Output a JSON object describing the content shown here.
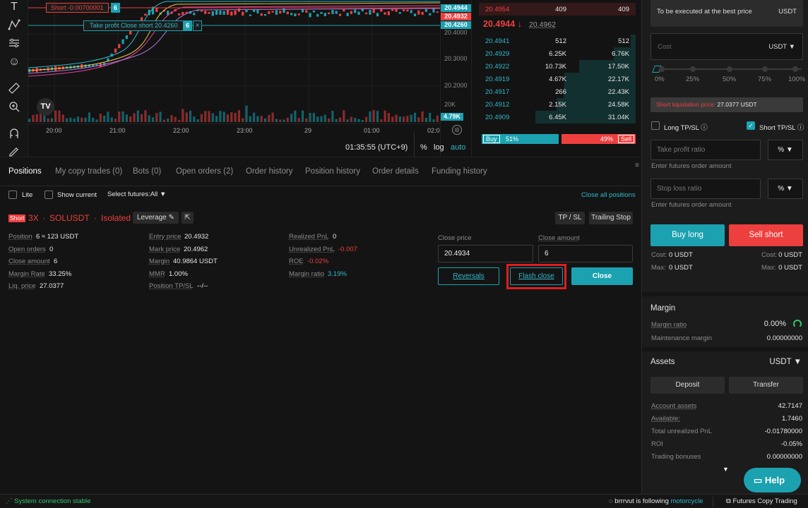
{
  "chart": {
    "time_labels": [
      "20:00",
      "21:00",
      "22:00",
      "23:00",
      "29",
      "01:00",
      "02:0"
    ],
    "price_labels": [
      "20.4000",
      "20.3000",
      "20.2000",
      "20K"
    ],
    "price_tags": [
      {
        "value": "20.4944",
        "color": "#1ba1b0"
      },
      {
        "value": "20.4932",
        "color": "#ee3f3f"
      },
      {
        "value": "20.4260",
        "color": "#1ba1b0"
      }
    ],
    "volume_tag": "4.79K",
    "short_line_label": "Short -0.00700001",
    "short_line_qty": "6",
    "tp_line_label": "Take profit Close short 20.4260",
    "tp_line_qty": "6",
    "clock": "01:35:55 (UTC+9)",
    "scale_percent": "%",
    "scale_log": "log",
    "scale_auto": "auto",
    "logo_text": "TV"
  },
  "orderbook": {
    "top_row": {
      "price": "20.4954",
      "amount": "409",
      "total": "409"
    },
    "last_price": "20.4944",
    "mark_price": "20.4962",
    "bids": [
      {
        "price": "20.4941",
        "amount": "512",
        "total": "512",
        "depth": 0.05
      },
      {
        "price": "20.4929",
        "amount": "6.25K",
        "total": "6.76K",
        "depth": 0.22
      },
      {
        "price": "20.4922",
        "amount": "10.73K",
        "total": "17.50K",
        "depth": 0.56
      },
      {
        "price": "20.4919",
        "amount": "4.67K",
        "total": "22.17K",
        "depth": 0.71
      },
      {
        "price": "20.4917",
        "amount": "266",
        "total": "22.43K",
        "depth": 0.72
      },
      {
        "price": "20.4912",
        "amount": "2.15K",
        "total": "24.58K",
        "depth": 0.79
      },
      {
        "price": "20.4909",
        "amount": "6.45K",
        "total": "31.04K",
        "depth": 1.0
      }
    ],
    "buy_label": "Buy",
    "buy_pct": "51%",
    "sell_pct": "49%",
    "sell_label": "Sell",
    "buy_ratio": 0.51
  },
  "tabs": [
    "Positions",
    "My copy trades (0)",
    "Bots (0)",
    "Open orders (2)",
    "Order history",
    "Position history",
    "Order details",
    "Funding history"
  ],
  "filters": {
    "lite": "Lite",
    "show_current": "Show current",
    "select_futures": "Select futures:All",
    "close_all": "Close all positions"
  },
  "position": {
    "side_badge": "Short",
    "leverage": "3X",
    "symbol": "SOLUSDT",
    "margin_mode": "Isolated",
    "leverage_btn": "Leverage",
    "tpsl_btn": "TP / SL",
    "trailing_btn": "Trailing Stop",
    "col1": [
      {
        "label": "Position",
        "value": "6 ≈ 123 USDT"
      },
      {
        "label": "Open orders",
        "value": "0"
      },
      {
        "label": "Close amount",
        "value": "6"
      },
      {
        "label": "Margin Rate",
        "value": "33.25%"
      },
      {
        "label": "Liq. price",
        "value": "27.0377"
      }
    ],
    "col2": [
      {
        "label": "Entry price",
        "value": "20.4932"
      },
      {
        "label": "Mark price",
        "value": "20.4962"
      },
      {
        "label": "Margin",
        "value": "40.9864 USDT"
      },
      {
        "label": "MMR",
        "value": "1.00%"
      },
      {
        "label": "Position TP/SL",
        "value": "--/--"
      }
    ],
    "col3": [
      {
        "label": "Realized PnL",
        "value": "0"
      },
      {
        "label": "Unrealized PnL",
        "value": "-0.007"
      },
      {
        "label": "ROE",
        "value": "-0.02%"
      },
      {
        "label": "Margin ratio",
        "value": "3.19%"
      }
    ],
    "close_price_label": "Close price",
    "close_price_value": "20.4934",
    "close_amount_label": "Close amount",
    "close_amount_value": "6",
    "reversals": "Reversals",
    "flash_close": "Flash close",
    "close": "Close"
  },
  "order_panel": {
    "best_price": "To be executed at the best price",
    "best_unit": "USDT",
    "cost_placeholder": "Cost",
    "cost_unit": "USDT",
    "slider_marks": [
      "0%",
      "25%",
      "50%",
      "75%",
      "100%"
    ],
    "liq_label": "Short liquidation price:",
    "liq_value": "27.0377 USDT",
    "long_tpsl": "Long TP/SL",
    "short_tpsl": "Short TP/SL",
    "tp_placeholder": "Take profit ratio",
    "tp_unit": "%",
    "tp_hint": "Enter futures order amount",
    "sl_placeholder": "Stop loss ratio",
    "sl_unit": "%",
    "sl_hint": "Enter futures order amount",
    "buy_long": "Buy long",
    "sell_short": "Sell short",
    "cost_label": "Cost:",
    "cost_value": "0 USDT",
    "max_label": "Max:",
    "max_value": "0 USDT"
  },
  "margin": {
    "title": "Margin",
    "ratio_label": "Margin ratio",
    "ratio_value": "0.00%",
    "maint_label": "Maintenance margin",
    "maint_value": "0.00000000"
  },
  "assets": {
    "title": "Assets",
    "currency": "USDT",
    "deposit": "Deposit",
    "transfer": "Transfer",
    "rows": [
      {
        "label": "Account assets",
        "value": "42.7147"
      },
      {
        "label": "Available:",
        "value": "1.7460"
      },
      {
        "label": "Total unrealized PnL",
        "value": "-0.01780000"
      },
      {
        "label": "ROI",
        "value": "-0.05%"
      },
      {
        "label": "Trading bonuses",
        "value": "0.00000000"
      }
    ],
    "help": "Help"
  },
  "status": {
    "connection": "System connection stable",
    "user": "brrrvut",
    "following_text": "is following",
    "followed": "motorcycle",
    "copy_trading": "Futures Copy Trading"
  },
  "colors": {
    "teal": "#1ba1b0",
    "red": "#ee3f3f",
    "green": "#35c46f",
    "highlight": "#e11d1d"
  }
}
